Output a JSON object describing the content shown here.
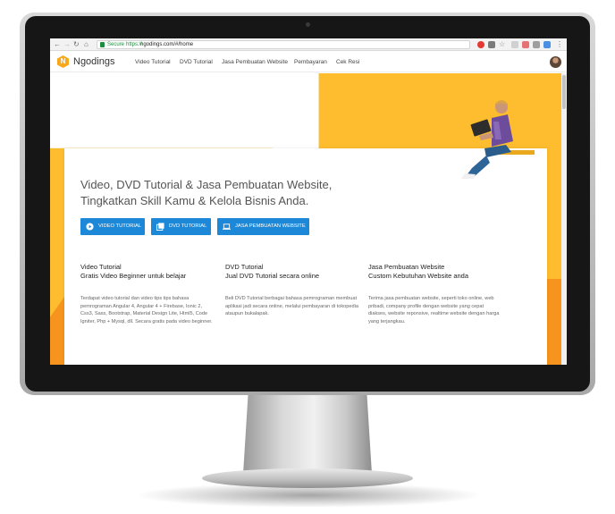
{
  "browser": {
    "secure_label": "Secure",
    "url_protocol": "https://",
    "url_rest": "ngodings.com/#/home"
  },
  "site": {
    "brand": "Ngodings",
    "logo_letter": "N",
    "menu": [
      "Video Tutorial",
      "DVD Tutorial",
      "Jasa Pembuatan Website",
      "Pembayaran",
      "Cek Resi"
    ]
  },
  "hero": {
    "title_line1": "Video, DVD Tutorial & Jasa Pembuatan Website,",
    "title_line2": "Tingkatkan Skill Kamu & Kelola Bisnis Anda.",
    "buttons": [
      {
        "label": "VIDEO TUTORIAL",
        "icon": "play-circle-icon"
      },
      {
        "label": "DVD TUTORIAL",
        "icon": "library-icon"
      },
      {
        "label": "JASA PEMBUATAN WEBSITE",
        "icon": "laptop-icon"
      }
    ]
  },
  "features": [
    {
      "title": "Video Tutorial",
      "subtitle": "Gratis Video Beginner untuk belajar",
      "body": "Terdapat video tutorial dan video tips tips bahasa pemrograman Angular 4, Angular 4 + Firebase, Ionic 2, Css3, Sass, Bootstrap, Material Design Lite, Html5, Code Igniter, Php + Mysql, dll. Secara gratis pada video beginner."
    },
    {
      "title": "DVD Tutorial",
      "subtitle": "Jual DVD Tutorial secara online",
      "body": "Beli DVD Tutorial berbagai bahasa pemrograman membuat aplikasi jadi secara online, melalui pembayaran di tokopedia ataupun bukalapak."
    },
    {
      "title": "Jasa Pembuatan Website",
      "subtitle": "Custom Kebutuhan Website anda",
      "body": "Terima jasa pembuatan website, seperti toko online, web pribadi, company profile dengan website yang cepat diakses, website reponsive, realtime website dengan harga yang terjangkau."
    }
  ],
  "colors": {
    "accent_yellow": "#fdbd2e",
    "accent_orange": "#f7941d",
    "button_blue": "#1e88d8"
  }
}
